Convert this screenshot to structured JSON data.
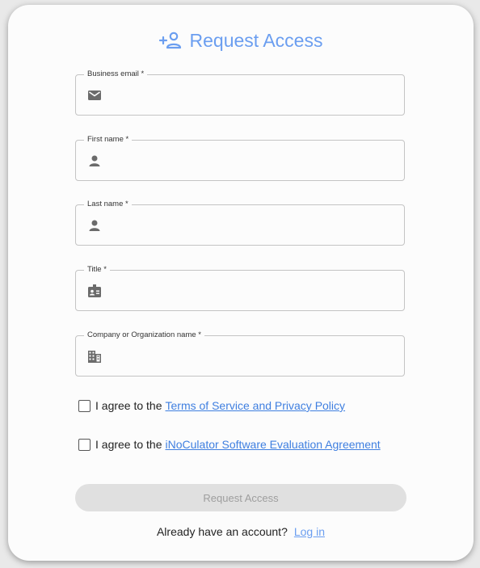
{
  "header": {
    "title": "Request Access",
    "icon": "person-add-icon"
  },
  "fields": [
    {
      "label": "Business email *",
      "value": "",
      "icon": "mail-icon"
    },
    {
      "label": "First name *",
      "value": "",
      "icon": "person-icon"
    },
    {
      "label": "Last name *",
      "value": "",
      "icon": "person-icon"
    },
    {
      "label": "Title *",
      "value": "",
      "icon": "badge-icon"
    },
    {
      "label": "Company or Organization name *",
      "value": "",
      "icon": "building-icon"
    }
  ],
  "agreements": [
    {
      "prefix": "I agree to the",
      "link": "Terms of Service and Privacy Policy",
      "checked": false
    },
    {
      "prefix": "I agree to the",
      "link": "iNoCulator Software Evaluation Agreement",
      "checked": false
    }
  ],
  "submit_label": "Request Access",
  "footer": {
    "text": "Already have an account?",
    "link": "Log in"
  },
  "colors": {
    "accent": "#6b9ef0",
    "link": "#3f7fe0",
    "disabled_bg": "#e0e0e0",
    "disabled_text": "#9e9e9e"
  }
}
